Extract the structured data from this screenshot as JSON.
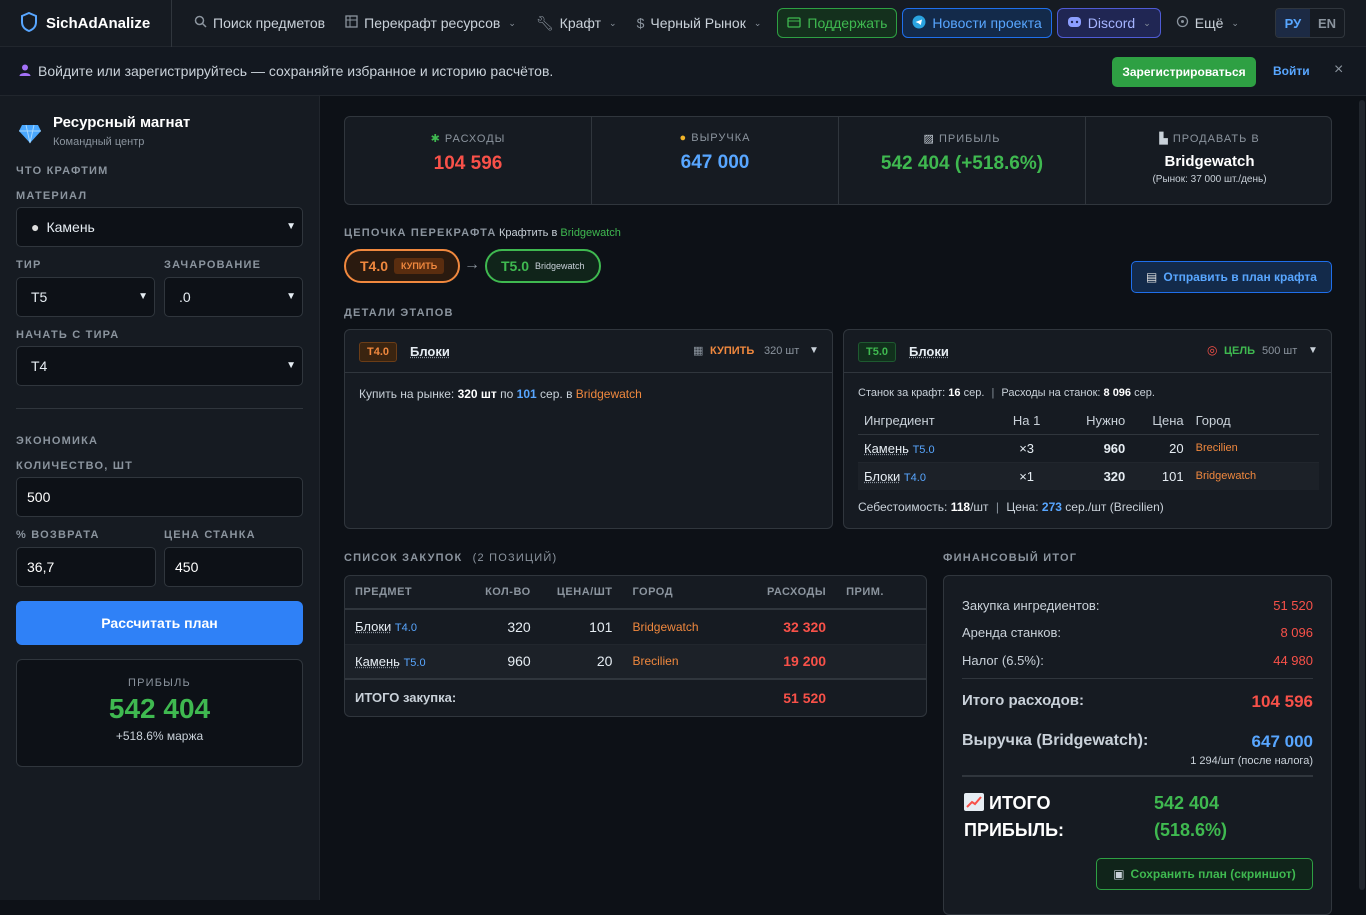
{
  "nav": {
    "brand": "SichAdAnalize",
    "items": [
      "Поиск предметов",
      "Перекрафт ресурсов",
      "Крафт",
      "Черный Рынок"
    ],
    "support": "Поддержать",
    "news": "Новости проекта",
    "discord": "Discord",
    "more": "Ещё",
    "lang_ru": "РУ",
    "lang_en": "EN"
  },
  "banner": {
    "text": "Войдите или зарегистрируйтесь — сохраняйте избранное и историю расчётов.",
    "register": "Зарегистрироваться",
    "login": "Войти",
    "close": "×"
  },
  "sidebar": {
    "title": "Ресурсный магнат",
    "subtitle": "Командный центр",
    "section_craft": "ЧТО КРАФТИМ",
    "material_label": "МАТЕРИАЛ",
    "material_value": "Камень",
    "tier_label": "ТИР",
    "tier_value": "T5",
    "enchant_label": "ЗАЧАРОВАНИЕ",
    "enchant_value": ".0",
    "start_tier_label": "НАЧАТЬ С ТИРА",
    "start_tier_value": "T4",
    "economy_label": "ЭКОНОМИКА",
    "qty_label": "КОЛИЧЕСТВО, ШТ",
    "qty_value": "500",
    "return_label": "% ВОЗВРАТА",
    "return_value": "36,7",
    "station_label": "ЦЕНА СТАНКА",
    "station_value": "450",
    "calc_button": "Рассчитать план",
    "profit_label": "ПРИБЫЛЬ",
    "profit_value": "542 404",
    "profit_margin": "+518.6% маржа"
  },
  "stats": {
    "expenses_label": "РАСХОДЫ",
    "expenses_value": "104 596",
    "revenue_label": "ВЫРУЧКА",
    "revenue_value": "647 000",
    "profit_label": "ПРИБЫЛЬ",
    "profit_value": "542 404 (+518.6%)",
    "sell_label": "ПРОДАВАТЬ В",
    "sell_city": "Bridgewatch",
    "sell_market": "(Рынок: 37 000 шт./день)"
  },
  "chain": {
    "title": "ЦЕПОЧКА ПЕРЕКРАФТА",
    "craft_in_prefix": "Крафтить в",
    "craft_in_city": "Bridgewatch",
    "step1_tier": "T4.0",
    "step1_tag": "КУПИТЬ",
    "arrow": "→",
    "step2_tier": "T5.0",
    "step2_city": "Bridgewatch",
    "send_button": "Отправить в план крафта"
  },
  "details": {
    "title": "ДЕТАЛИ ЭТАПОВ",
    "left": {
      "tier": "T4.0",
      "name": "Блоки",
      "action": "КУПИТЬ",
      "qty": "320 шт",
      "buy_prefix": "Купить на рынке:",
      "buy_qty": "320 шт",
      "buy_by": "по",
      "buy_price": "101",
      "buy_unit": "сер. в",
      "buy_city": "Bridgewatch"
    },
    "right": {
      "tier": "T5.0",
      "name": "Блоки",
      "action": "ЦЕЛЬ",
      "qty": "500 шт",
      "station_prefix": "Станок за крафт:",
      "station_value": "16",
      "station_unit": "сер.",
      "station_total_prefix": "Расходы на станок:",
      "station_total": "8 096",
      "station_total_unit": "сер.",
      "headers": [
        "Ингредиент",
        "На 1",
        "Нужно",
        "Цена",
        "Город"
      ],
      "rows": [
        {
          "name": "Камень",
          "tier": "T5.0",
          "per": "×3",
          "need": "960",
          "price": "20",
          "city": "Brecilien"
        },
        {
          "name": "Блоки",
          "tier": "T4.0",
          "per": "×1",
          "need": "320",
          "price": "101",
          "city": "Bridgewatch"
        }
      ],
      "cost_prefix": "Себестоимость:",
      "cost_value": "118",
      "cost_unit": "/шт",
      "price_prefix": "Цена:",
      "price_value": "273",
      "price_unit": "сер./шт (Brecilien)"
    }
  },
  "purchases": {
    "title": "СПИСОК ЗАКУПОК",
    "count": "(2 ПОЗИЦИЙ)",
    "headers": [
      "ПРЕДМЕТ",
      "КОЛ-ВО",
      "ЦЕНА/ШТ",
      "ГОРОД",
      "РАСХОДЫ",
      "ПРИМ."
    ],
    "rows": [
      {
        "name": "Блоки",
        "tier": "T4.0",
        "qty": "320",
        "price": "101",
        "city": "Bridgewatch",
        "cost": "32 320"
      },
      {
        "name": "Камень",
        "tier": "T5.0",
        "qty": "960",
        "price": "20",
        "city": "Brecilien",
        "cost": "19 200"
      }
    ],
    "total_label": "ИТОГО закупка:",
    "total_value": "51 520"
  },
  "finance": {
    "title": "ФИНАНСОВЫЙ ИТОГ",
    "ingredients_label": "Закупка ингредиентов:",
    "ingredients_value": "51 520",
    "rent_label": "Аренда станков:",
    "rent_value": "8 096",
    "tax_label": "Налог (6.5%):",
    "tax_value": "44 980",
    "total_exp_label": "Итого расходов:",
    "total_exp_value": "104 596",
    "revenue_label": "Выручка (Bridgewatch):",
    "revenue_value": "647 000",
    "revenue_note": "1 294/шт (после налога)",
    "profit_label_1": "ИТОГО",
    "profit_label_2": "ПРИБЫЛЬ:",
    "profit_value_1": "542 404",
    "profit_value_2": "(518.6%)",
    "save_button": "Сохранить план (скриншот)"
  },
  "colors": {
    "accent_blue": "#2f81f7",
    "profit_green": "#3fb950",
    "expense_red": "#f85149",
    "city_orange": "#f0883e"
  }
}
